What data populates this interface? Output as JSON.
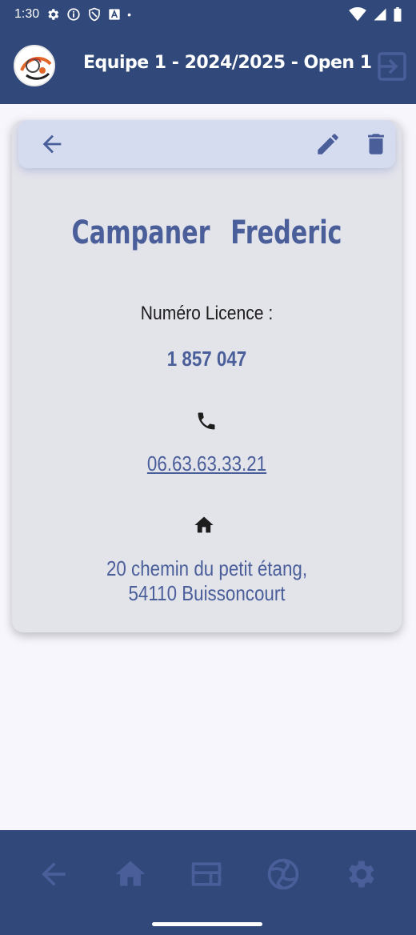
{
  "status_bar": {
    "time": "1:30",
    "icons": [
      "settings-gear-icon",
      "info-icon",
      "shield-icon",
      "a-box-icon",
      "dot-icon",
      "wifi-icon",
      "signal-icon",
      "battery-icon"
    ],
    "dot": "•"
  },
  "app_bar": {
    "title": "Equipe 1 - 2024/2025 - Open 1",
    "logo_icon": "club-logo-icon",
    "action_icon": "logout-icon"
  },
  "player_card": {
    "toolbar": {
      "back_icon": "arrow-left-icon",
      "edit_icon": "pencil-icon",
      "delete_icon": "trash-icon"
    },
    "last_name": "Campaner",
    "first_name": "Frederic",
    "licence_label": "Numéro Licence :",
    "licence_number": "1 857 047",
    "phone_icon": "phone-icon",
    "phone": "06.63.63.33.21",
    "address_icon": "home-icon",
    "address_line1": "20 chemin du petit étang,",
    "address_line2": "54110 Buissoncourt"
  },
  "bottom_nav": {
    "items": [
      {
        "icon": "arrow-left-icon"
      },
      {
        "icon": "home-icon"
      },
      {
        "icon": "card-list-icon"
      },
      {
        "icon": "sport-ball-icon"
      },
      {
        "icon": "gear-icon"
      }
    ]
  },
  "colors": {
    "primary": "#31497a",
    "accent": "#4a5f9a",
    "card_bg": "#e3e3ea",
    "toolbar_bg": "#d6dcf0",
    "nav_icon": "#4a5f9a"
  }
}
